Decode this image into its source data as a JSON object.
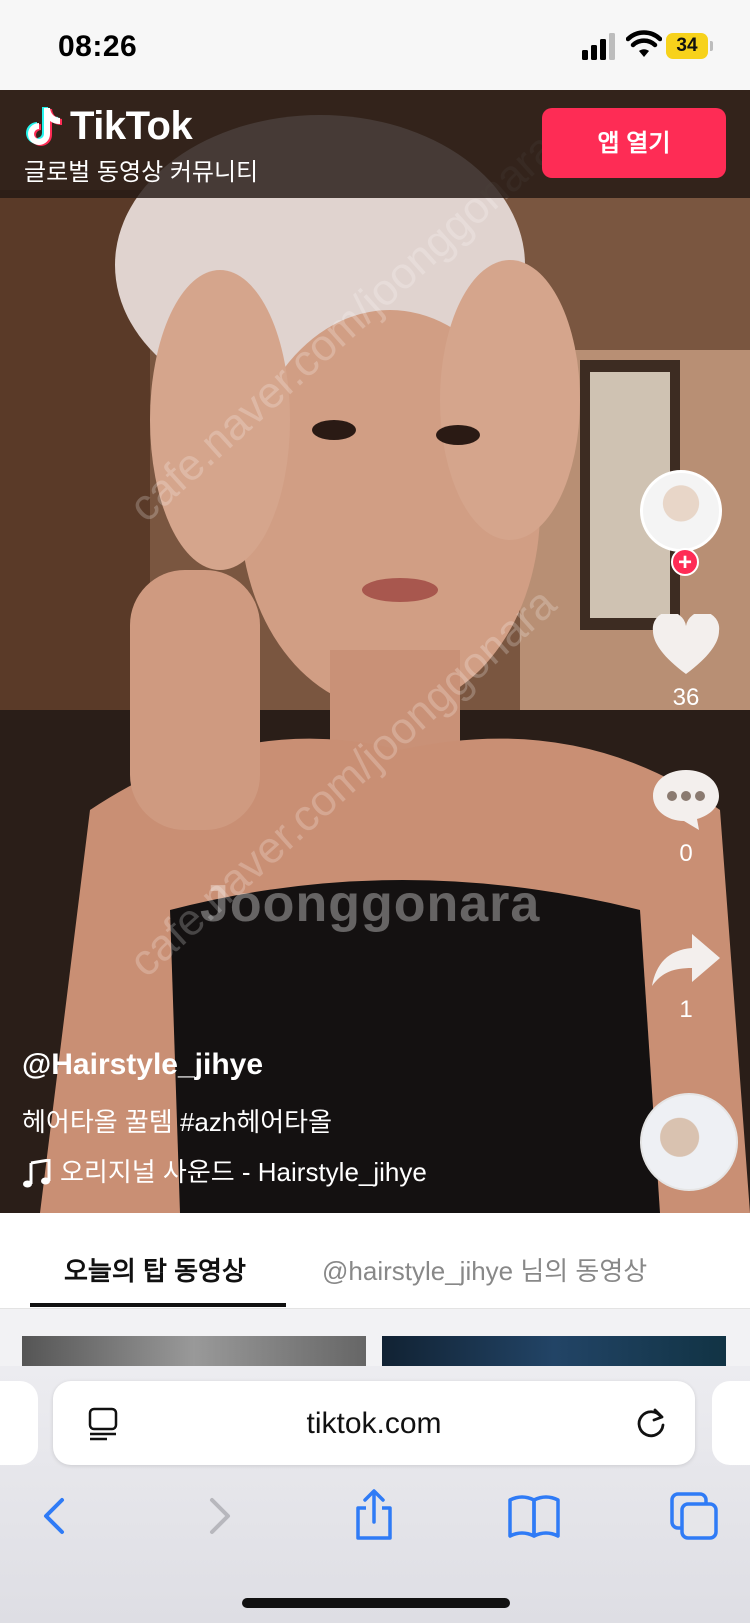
{
  "status_bar": {
    "time": "08:26",
    "battery": "34"
  },
  "banner": {
    "brand": "TikTok",
    "subtitle": "글로벌 동영상 커뮤니티",
    "open_app": "앱 열기"
  },
  "actions": {
    "likes": "36",
    "comments": "0",
    "shares": "1"
  },
  "caption": {
    "username": "@Hairstyle_jihye",
    "description": "헤어타올 꿀템 #azh헤어타올",
    "music": "오리지널 사운드 - Hairstyle_jihye"
  },
  "watermark": {
    "brand": "Joonggonara",
    "url": "cafe.naver.com/joonggonara"
  },
  "tabs": {
    "active": "오늘의 탑 동영상",
    "inactive": "@hairstyle_jihye 님의 동영상"
  },
  "browser": {
    "url": "tiktok.com"
  },
  "colors": {
    "accent": "#fe2c55",
    "ios_blue": "#2f7bf6"
  }
}
